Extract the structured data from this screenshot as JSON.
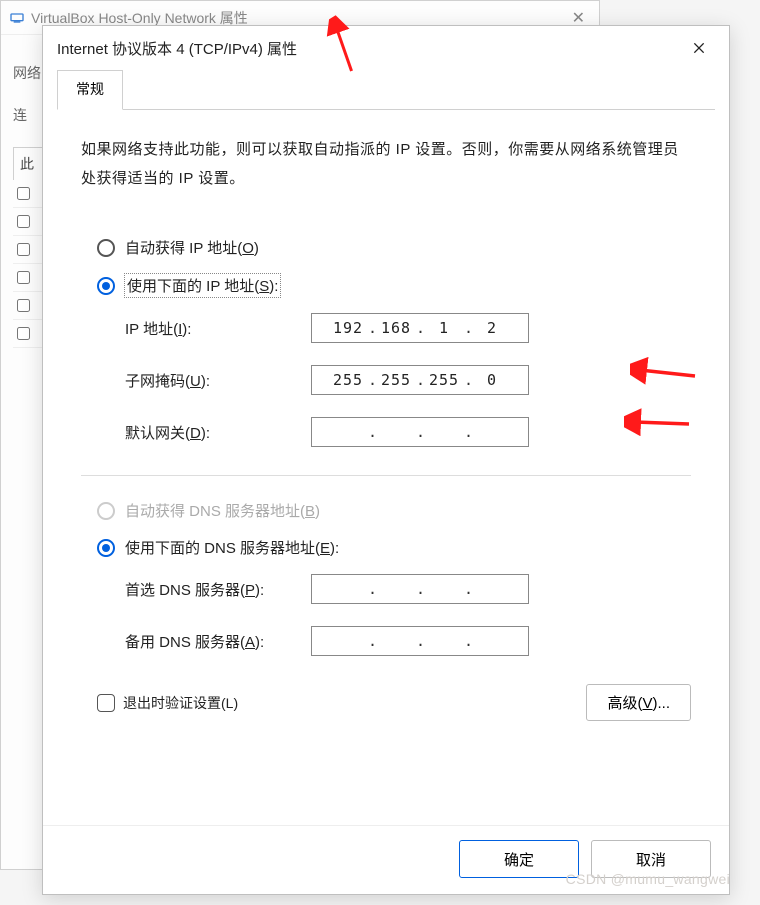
{
  "parent_window": {
    "title": "VirtualBox Host-Only Network 属性",
    "labels": {
      "network_prefix": "网络",
      "connection_prefix": "连",
      "this_prefix": "此"
    }
  },
  "dialog": {
    "title": "Internet 协议版本 4 (TCP/IPv4) 属性",
    "tab_general": "常规",
    "description": "如果网络支持此功能，则可以获取自动指派的 IP 设置。否则，你需要从网络系统管理员处获得适当的 IP 设置。",
    "radios": {
      "auto_ip_pre": "自动获得 IP 地址(",
      "auto_ip_key": "O",
      "auto_ip_post": ")",
      "manual_ip_pre": "使用下面的 IP 地址(",
      "manual_ip_key": "S",
      "manual_ip_post": "):",
      "auto_dns_pre": "自动获得 DNS 服务器地址(",
      "auto_dns_key": "B",
      "auto_dns_post": ")",
      "manual_dns_pre": "使用下面的 DNS 服务器地址(",
      "manual_dns_key": "E",
      "manual_dns_post": "):"
    },
    "fields": {
      "ip_label_pre": "IP 地址(",
      "ip_label_key": "I",
      "ip_label_post": "):",
      "ip_value": {
        "a": "192",
        "b": "168",
        "c": "1",
        "d": "2"
      },
      "mask_label_pre": "子网掩码(",
      "mask_label_key": "U",
      "mask_label_post": "):",
      "mask_value": {
        "a": "255",
        "b": "255",
        "c": "255",
        "d": "0"
      },
      "gateway_label_pre": "默认网关(",
      "gateway_label_key": "D",
      "gateway_label_post": "):",
      "gateway_value": {
        "a": "",
        "b": "",
        "c": "",
        "d": ""
      },
      "dns1_label_pre": "首选 DNS 服务器(",
      "dns1_label_key": "P",
      "dns1_label_post": "):",
      "dns1_value": {
        "a": "",
        "b": "",
        "c": "",
        "d": ""
      },
      "dns2_label_pre": "备用 DNS 服务器(",
      "dns2_label_key": "A",
      "dns2_label_post": "):",
      "dns2_value": {
        "a": "",
        "b": "",
        "c": "",
        "d": ""
      }
    },
    "validate_on_exit_pre": "退出时验证设置(",
    "validate_on_exit_key": "L",
    "validate_on_exit_post": ")",
    "advanced_pre": "高级(",
    "advanced_key": "V",
    "advanced_post": ")...",
    "ok": "确定",
    "cancel": "取消"
  },
  "watermark": "CSDN @mumu_wangwei"
}
